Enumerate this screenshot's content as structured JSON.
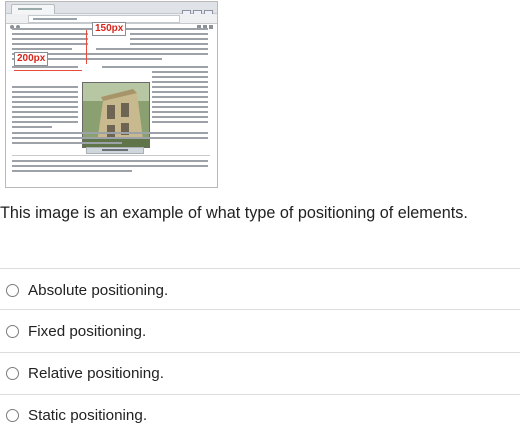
{
  "screenshot": {
    "label_top": "150px",
    "label_left": "200px",
    "accent_color": "#d8261c"
  },
  "question": {
    "text": "This image is an example of what type of positioning of elements."
  },
  "options": [
    {
      "label": "Absolute positioning.",
      "selected": false
    },
    {
      "label": "Fixed positioning.",
      "selected": false
    },
    {
      "label": "Relative positioning.",
      "selected": false
    },
    {
      "label": "Static positioning.",
      "selected": false
    }
  ]
}
